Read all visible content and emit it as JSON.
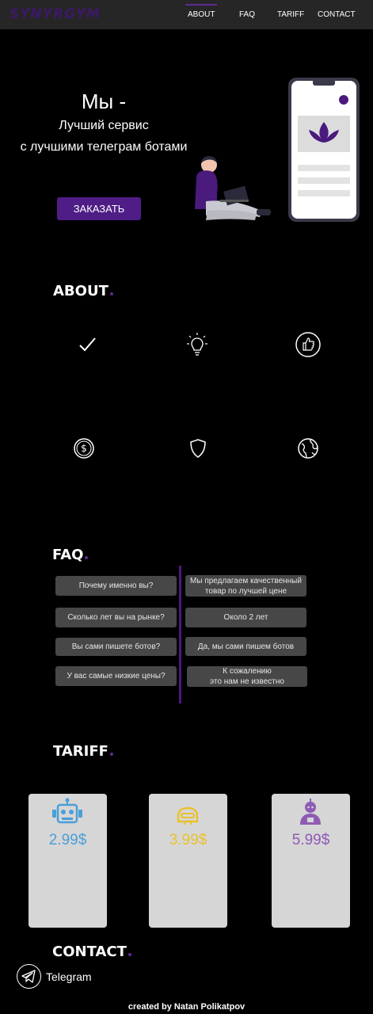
{
  "header": {
    "logo": "SYNYRGYM",
    "nav": [
      "ABOUT",
      "FAQ",
      "TARIFF",
      "CONTACT"
    ],
    "active_nav": "ABOUT"
  },
  "hero": {
    "title": "Мы -",
    "subtitle_line1": "Лучший сервис",
    "subtitle_line2": "с лучшими телеграм ботами",
    "order_button": "ЗАКАЗАТЬ"
  },
  "about": {
    "title": "ABOUT",
    "icons": [
      "check-icon",
      "lightbulb-icon",
      "thumbs-up-icon",
      "dollar-icon",
      "shield-icon",
      "globe-icon"
    ]
  },
  "faq": {
    "title": "FAQ",
    "items": [
      {
        "question": "Почему именно вы?",
        "answer_line1": "Мы предлагаем качественный",
        "answer_line2": "товар по лучшей цене"
      },
      {
        "question": "Сколько лет вы на рынке?",
        "answer_line1": "Около 2 лет",
        "answer_line2": ""
      },
      {
        "question": "Вы сами пишете ботов?",
        "answer_line1": "Да, мы сами пишем ботов",
        "answer_line2": ""
      },
      {
        "question": "У вас самые низкие цены?",
        "answer_line1": "К сожалению",
        "answer_line2": "это нам не известно"
      }
    ]
  },
  "tariff": {
    "title": "TARIFF",
    "cards": [
      {
        "price": "2.99$",
        "icon": "robot-icon",
        "color": "#4a9fd8"
      },
      {
        "price": "3.99$",
        "icon": "helmet-robot-icon",
        "color": "#e8c22e"
      },
      {
        "price": "5.99$",
        "icon": "android-icon",
        "color": "#8e5bb5"
      }
    ]
  },
  "contact": {
    "title": "CONTACT",
    "telegram_label": "Telegram"
  },
  "footer": "created by Natan Polikatpov",
  "colors": {
    "accent": "#5e2a91",
    "header_bg": "#262626",
    "faq_button": "#474747",
    "card_bg": "#d6d6d6"
  }
}
